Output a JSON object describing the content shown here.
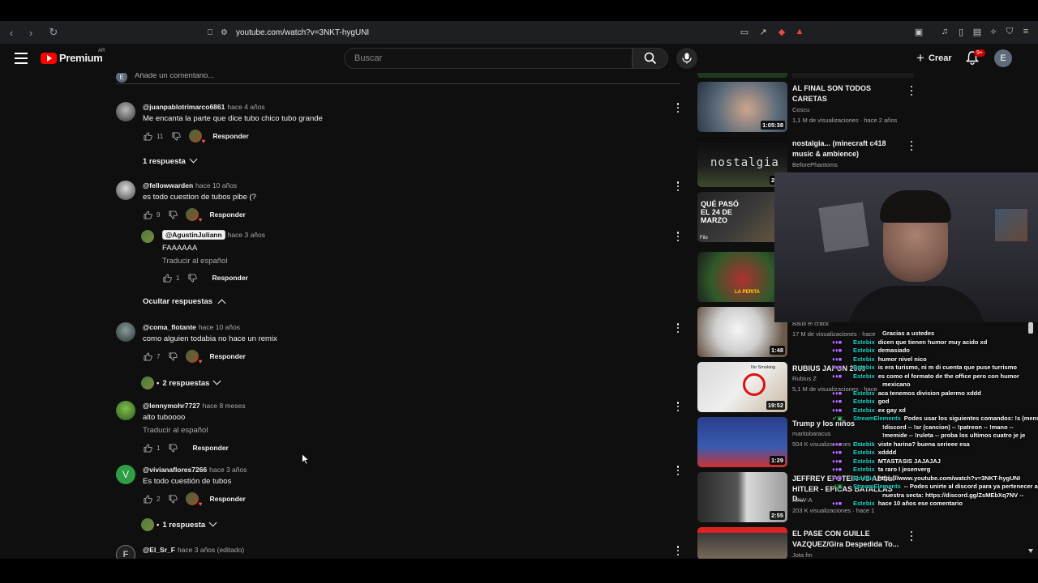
{
  "browser": {
    "url": "youtube.com/watch?v=3NKT-hygUNI"
  },
  "header": {
    "logo_text": "Premium",
    "logo_country": "AR",
    "search_placeholder": "Buscar",
    "create_label": "Crear",
    "notifications_badge": "9+",
    "user_initial": "E"
  },
  "comments_area": {
    "add_comment_placeholder": "Añade un comentario...",
    "add_comment_initial": "E",
    "reply_label": "Responder",
    "translate_label": "Traducir al español"
  },
  "comments": [
    {
      "user": "@juanpablotrimarco6861",
      "time": "hace 4 años",
      "text": "Me encanta la parte que dice tubo chico tubo grande",
      "likes": "11",
      "replies_toggle": "1 respuesta"
    },
    {
      "user": "@fellowwarden",
      "time": "hace 10 años",
      "text": "es todo cuestion de tubos pibe (?",
      "likes": "9"
    },
    {
      "user": "@AgustinJuliann",
      "time": "hace 3 años",
      "text": "FAAAAAA",
      "likes": "1",
      "is_reply": true
    },
    {
      "user": "@coma_flotante",
      "time": "hace 10 años",
      "text": "como alguien todabia no hace un remix",
      "likes": "7",
      "replies_toggle": "2 respuestas"
    },
    {
      "user": "@lennymohr7727",
      "time": "hace 8 meses",
      "text": "alto tuboooo",
      "likes": "1"
    },
    {
      "user": "@vivianaflores7266",
      "time": "hace 3 años",
      "text": "Es todo cuestión de tubos",
      "likes": "2",
      "replies_toggle": "1 respuesta",
      "avatar_letter": "V"
    },
    {
      "user": "@El_Sr_F",
      "time": "hace 3 años (editado)",
      "avatar_letter": "F"
    }
  ],
  "hide_replies_label": "Ocultar respuestas",
  "bullet": "•",
  "sidebar": [
    {
      "title": "AL FINAL SON TODOS CARETAS",
      "channel": "Coscu",
      "meta": "1,1 M de visualizaciones · hace 2 años",
      "duration": "1:05:38"
    },
    {
      "title": "nostalgia... (minecraft c418 music & ambience)",
      "channel": "BeforePhantoms",
      "meta": "",
      "duration": "2:00",
      "thumb_text": "nostalgia"
    },
    {
      "title": "",
      "channel": "",
      "meta": "",
      "duration": "",
      "thumb_text": "QUÉ PASÓ EL 24 DE MARZO",
      "thumb_sub": "Filo"
    },
    {
      "title": "",
      "channel": "",
      "meta": "",
      "duration": "",
      "thumb_text": "LA PERITA"
    },
    {
      "title": "",
      "channel": "Bauti el crack",
      "meta": "17 M de visualizaciones · hace",
      "duration": "1:48"
    },
    {
      "title": "RUBIUS JAPON 2009",
      "channel": "Rubius Z",
      "meta": "5,1 M de visualizaciones · hace",
      "duration": "19:52",
      "thumb_text": "No Smoking"
    },
    {
      "title": "Trump y los niños",
      "channel": "maritobaracus",
      "meta": "504 K visualizaciones · hace 5",
      "duration": "1:29"
    },
    {
      "title": "JEFFREY EPSTEIN VS ADOLF HITLER - EPICAS BATALLAS D...",
      "channel": "RAW-A",
      "meta": "203 K visualizaciones · hace 1",
      "duration": "2:55"
    },
    {
      "title": "EL PASE CON GUILLE VAZQUEZ/Gira Despedida To...",
      "channel": "Jota fm",
      "meta": "",
      "duration": ""
    }
  ],
  "chat": [
    {
      "name": "",
      "text": "Gracias a ustedes"
    },
    {
      "name": "Estebix",
      "text": "dicen que tienen humor muy acido xd"
    },
    {
      "name": "Estebix",
      "text": "demasiado"
    },
    {
      "name": "Estebix",
      "text": "humor nivel nico"
    },
    {
      "name": "Estebix",
      "text": "is era turismo, ni m di cuenta que puse turrismo"
    },
    {
      "name": "Estebix",
      "text": "es como el formato de the office pero con humor"
    },
    {
      "name": "",
      "text": "mexicano"
    },
    {
      "name": "Estebix",
      "text": "aca tenemos division palermo xddd"
    },
    {
      "name": "Estebix",
      "text": "god"
    },
    {
      "name": "Estebix",
      "text": "ex gay xd"
    },
    {
      "name": "StreamElements",
      "text": "Podes usar los siguientes comandos: !s (mensaje) -"
    },
    {
      "name": "",
      "text": "!discord -- !sr (cancion) -- !patreon -- !mano --"
    },
    {
      "name": "",
      "text": "!memide -- !ruleta -- proba los ultimos cuatro je je"
    },
    {
      "name": "Estebix",
      "text": "viste harina? buena serieee esa"
    },
    {
      "name": "Estebix",
      "text": "xdddd"
    },
    {
      "name": "Estebix",
      "text": "MTASTASIS JAJAJAJ"
    },
    {
      "name": "Estebix",
      "text": "ta raro I jesenverg"
    },
    {
      "name": "Estebix",
      "text": "https://www.youtube.com/watch?v=3NKT-hygUNI"
    },
    {
      "name": "StreamElements",
      "text": "-- Podes unirte al discord para ya pertenecer a"
    },
    {
      "name": "",
      "text": "nuestra secta: https://discord.gg/ZsMEbXq7NV --"
    },
    {
      "name": "Estebix",
      "text": "hace 10 años ese comentario"
    }
  ],
  "colors": {
    "background": "#0f0f0f",
    "text_primary": "#f1f1f1",
    "text_secondary": "#aaaaaa",
    "brand_red": "#ff0000",
    "chat_name": "#16d6c8"
  }
}
